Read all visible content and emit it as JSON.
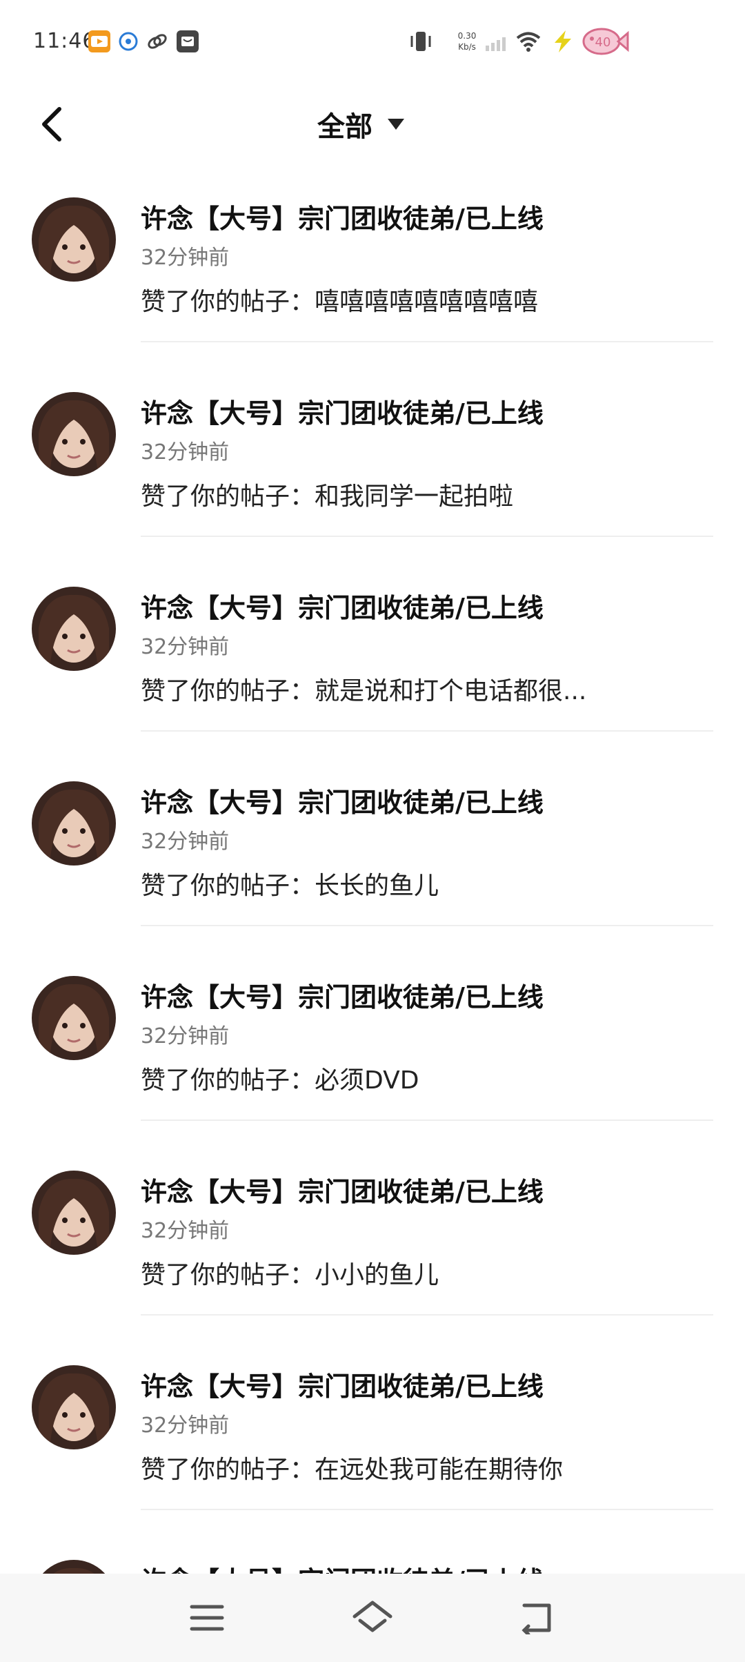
{
  "status_bar": {
    "time": "11:46",
    "net_speed_value": "0.30",
    "net_speed_unit": "Kb/s",
    "icons": [
      "video-app-icon",
      "iflytek-app-icon",
      "link-app-icon",
      "message-app-icon",
      "vibrate-icon",
      "signal-icon",
      "wifi-icon",
      "charging-icon",
      "battery-icon"
    ],
    "battery_label": "40"
  },
  "header": {
    "title": "全部",
    "back_icon": "back-chevron-icon",
    "dropdown_icon": "caret-down-icon"
  },
  "notifications": [
    {
      "name": "许念【大号】宗门团收徒弟/已上线",
      "time": "32分钟前",
      "action": "赞了你的帖子：嘻嘻嘻嘻嘻嘻嘻嘻嘻"
    },
    {
      "name": "许念【大号】宗门团收徒弟/已上线",
      "time": "32分钟前",
      "action": "赞了你的帖子：和我同学一起拍啦"
    },
    {
      "name": "许念【大号】宗门团收徒弟/已上线",
      "time": "32分钟前",
      "action": "赞了你的帖子：就是说和打个电话都很..."
    },
    {
      "name": "许念【大号】宗门团收徒弟/已上线",
      "time": "32分钟前",
      "action": "赞了你的帖子：长长的鱼儿"
    },
    {
      "name": "许念【大号】宗门团收徒弟/已上线",
      "time": "32分钟前",
      "action": "赞了你的帖子：必须DVD"
    },
    {
      "name": "许念【大号】宗门团收徒弟/已上线",
      "time": "32分钟前",
      "action": "赞了你的帖子：小小的鱼儿"
    },
    {
      "name": "许念【大号】宗门团收徒弟/已上线",
      "time": "32分钟前",
      "action": "赞了你的帖子：在远处我可能在期待你"
    },
    {
      "name": "许念【大号】宗门团收徒弟/已上线",
      "time": "",
      "action": ""
    }
  ],
  "bottom_nav": {
    "icons": [
      "menu-icon",
      "home-icon",
      "back-icon"
    ]
  },
  "colors": {
    "background": "#ffffff",
    "text_primary": "#111111",
    "text_secondary": "#777777",
    "divider": "#eeeeee",
    "nav_bar": "#f7f7f7"
  }
}
